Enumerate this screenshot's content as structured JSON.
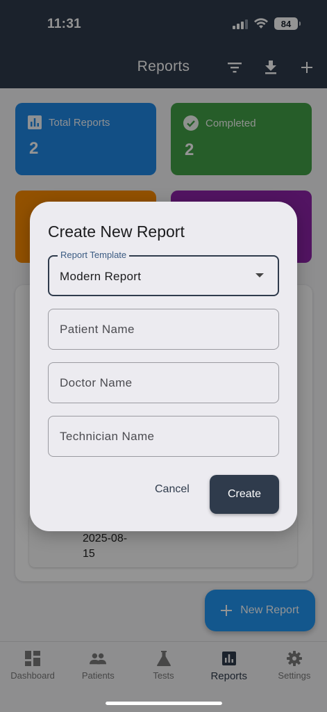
{
  "status_bar": {
    "time": "11:31",
    "battery": "84"
  },
  "header": {
    "title": "Reports"
  },
  "stats": [
    {
      "label": "Total Reports",
      "count": "2",
      "color": "#1f88e5"
    },
    {
      "label": "Completed",
      "count": "2",
      "color": "#43a047"
    },
    {
      "label": "",
      "count": "",
      "color": "#fb8c00"
    },
    {
      "label": "",
      "count": "",
      "color": "#8e24aa"
    }
  ],
  "list": {
    "item_date": "2025-08-15"
  },
  "fab": {
    "label": "New Report"
  },
  "bottom_nav": [
    {
      "label": "Dashboard",
      "icon": "dashboard-icon",
      "active": false
    },
    {
      "label": "Patients",
      "icon": "people-icon",
      "active": false
    },
    {
      "label": "Tests",
      "icon": "flask-icon",
      "active": false
    },
    {
      "label": "Reports",
      "icon": "bar-chart-icon",
      "active": true
    },
    {
      "label": "Settings",
      "icon": "gear-icon",
      "active": false
    }
  ],
  "dialog": {
    "title": "Create New Report",
    "template_label": "Report Template",
    "template_value": "Modern Report",
    "patient_placeholder": "Patient Name",
    "doctor_placeholder": "Doctor Name",
    "technician_placeholder": "Technician Name",
    "cancel_label": "Cancel",
    "create_label": "Create"
  },
  "colors": {
    "primary": "#2f3b4c",
    "accent": "#2196f3",
    "dialog_bg": "#ecebf0"
  }
}
